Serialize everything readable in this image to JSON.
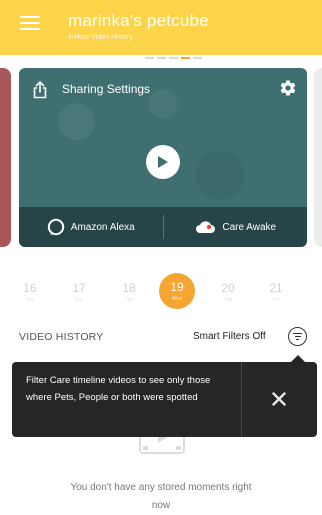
{
  "header": {
    "title": "marinka's petcube",
    "subtitle": "4-Hour Video History",
    "menu_icon": "hamburger-icon"
  },
  "camera_card": {
    "sharing_label": "Sharing Settings",
    "share_icon": "share-icon",
    "settings_icon": "gear-icon",
    "play_icon": "play-icon",
    "alexa_label": "Amazon Alexa",
    "care_label": "Care Awake"
  },
  "dates": [
    {
      "num": "16",
      "dow": "Sat"
    },
    {
      "num": "17",
      "dow": "Sun"
    },
    {
      "num": "18",
      "dow": "Tue"
    },
    {
      "num": "19",
      "dow": "Wed"
    },
    {
      "num": "20",
      "dow": "Thu"
    },
    {
      "num": "21",
      "dow": "Fri"
    }
  ],
  "history": {
    "title": "VIDEO HISTORY",
    "smart_filters": "Smart Filters Off"
  },
  "tooltip": {
    "text": "Filter Care timeline videos to see only those where Pets, People or both were spotted"
  },
  "empty_state": {
    "text": "You don't have any stored moments right now"
  },
  "colors": {
    "accent_yellow": "#fbd44a",
    "date_selected": "#f7a532",
    "card_bg": "#3f6f70",
    "tooltip_bg": "#262626"
  }
}
